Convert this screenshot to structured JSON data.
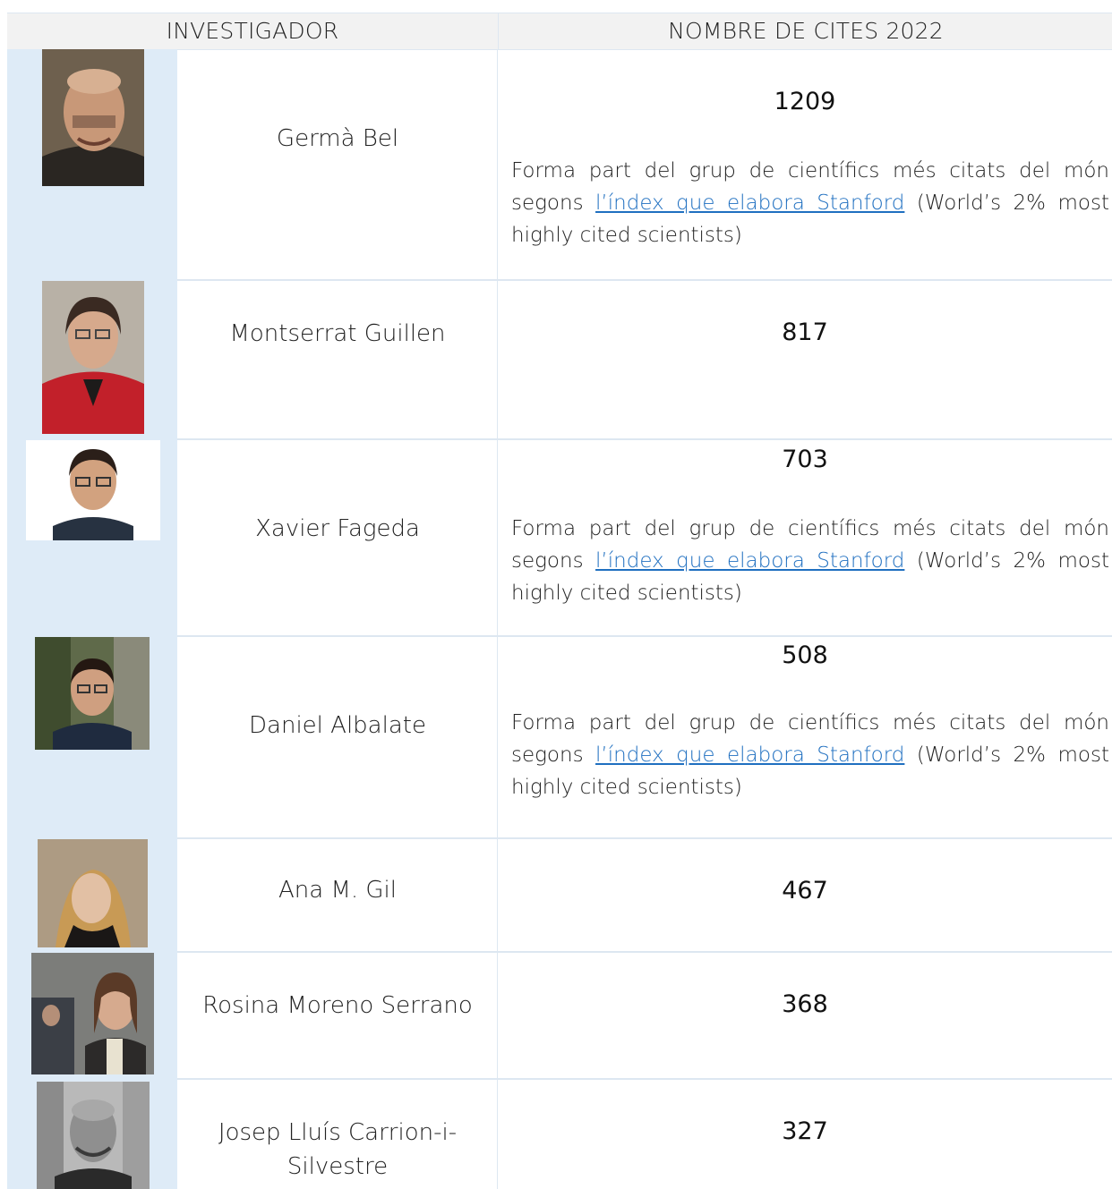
{
  "table": {
    "headers": {
      "researcher": "INVESTIGADOR",
      "citations": "NOMBRE DE CITES 2022"
    },
    "note": {
      "prefix": "Forma part del grup de científics més citats del món segons ",
      "link": "l’índex que elabora Stanford",
      "suffix": " (World’s 2% most highly cited scientists)"
    },
    "rows": [
      {
        "name": "Germà Bel",
        "cites": "1209"
      },
      {
        "name": "Montserrat Guillen",
        "cites": "817"
      },
      {
        "name": "Xavier Fageda",
        "cites": "703"
      },
      {
        "name": "Daniel Albalate",
        "cites": "508"
      },
      {
        "name": "Ana M. Gil",
        "cites": "467"
      },
      {
        "name": "Rosina Moreno Serrano",
        "cites": "368"
      },
      {
        "name": "Josep Lluís Carrion-i-Silvestre",
        "cites": "327"
      }
    ]
  }
}
